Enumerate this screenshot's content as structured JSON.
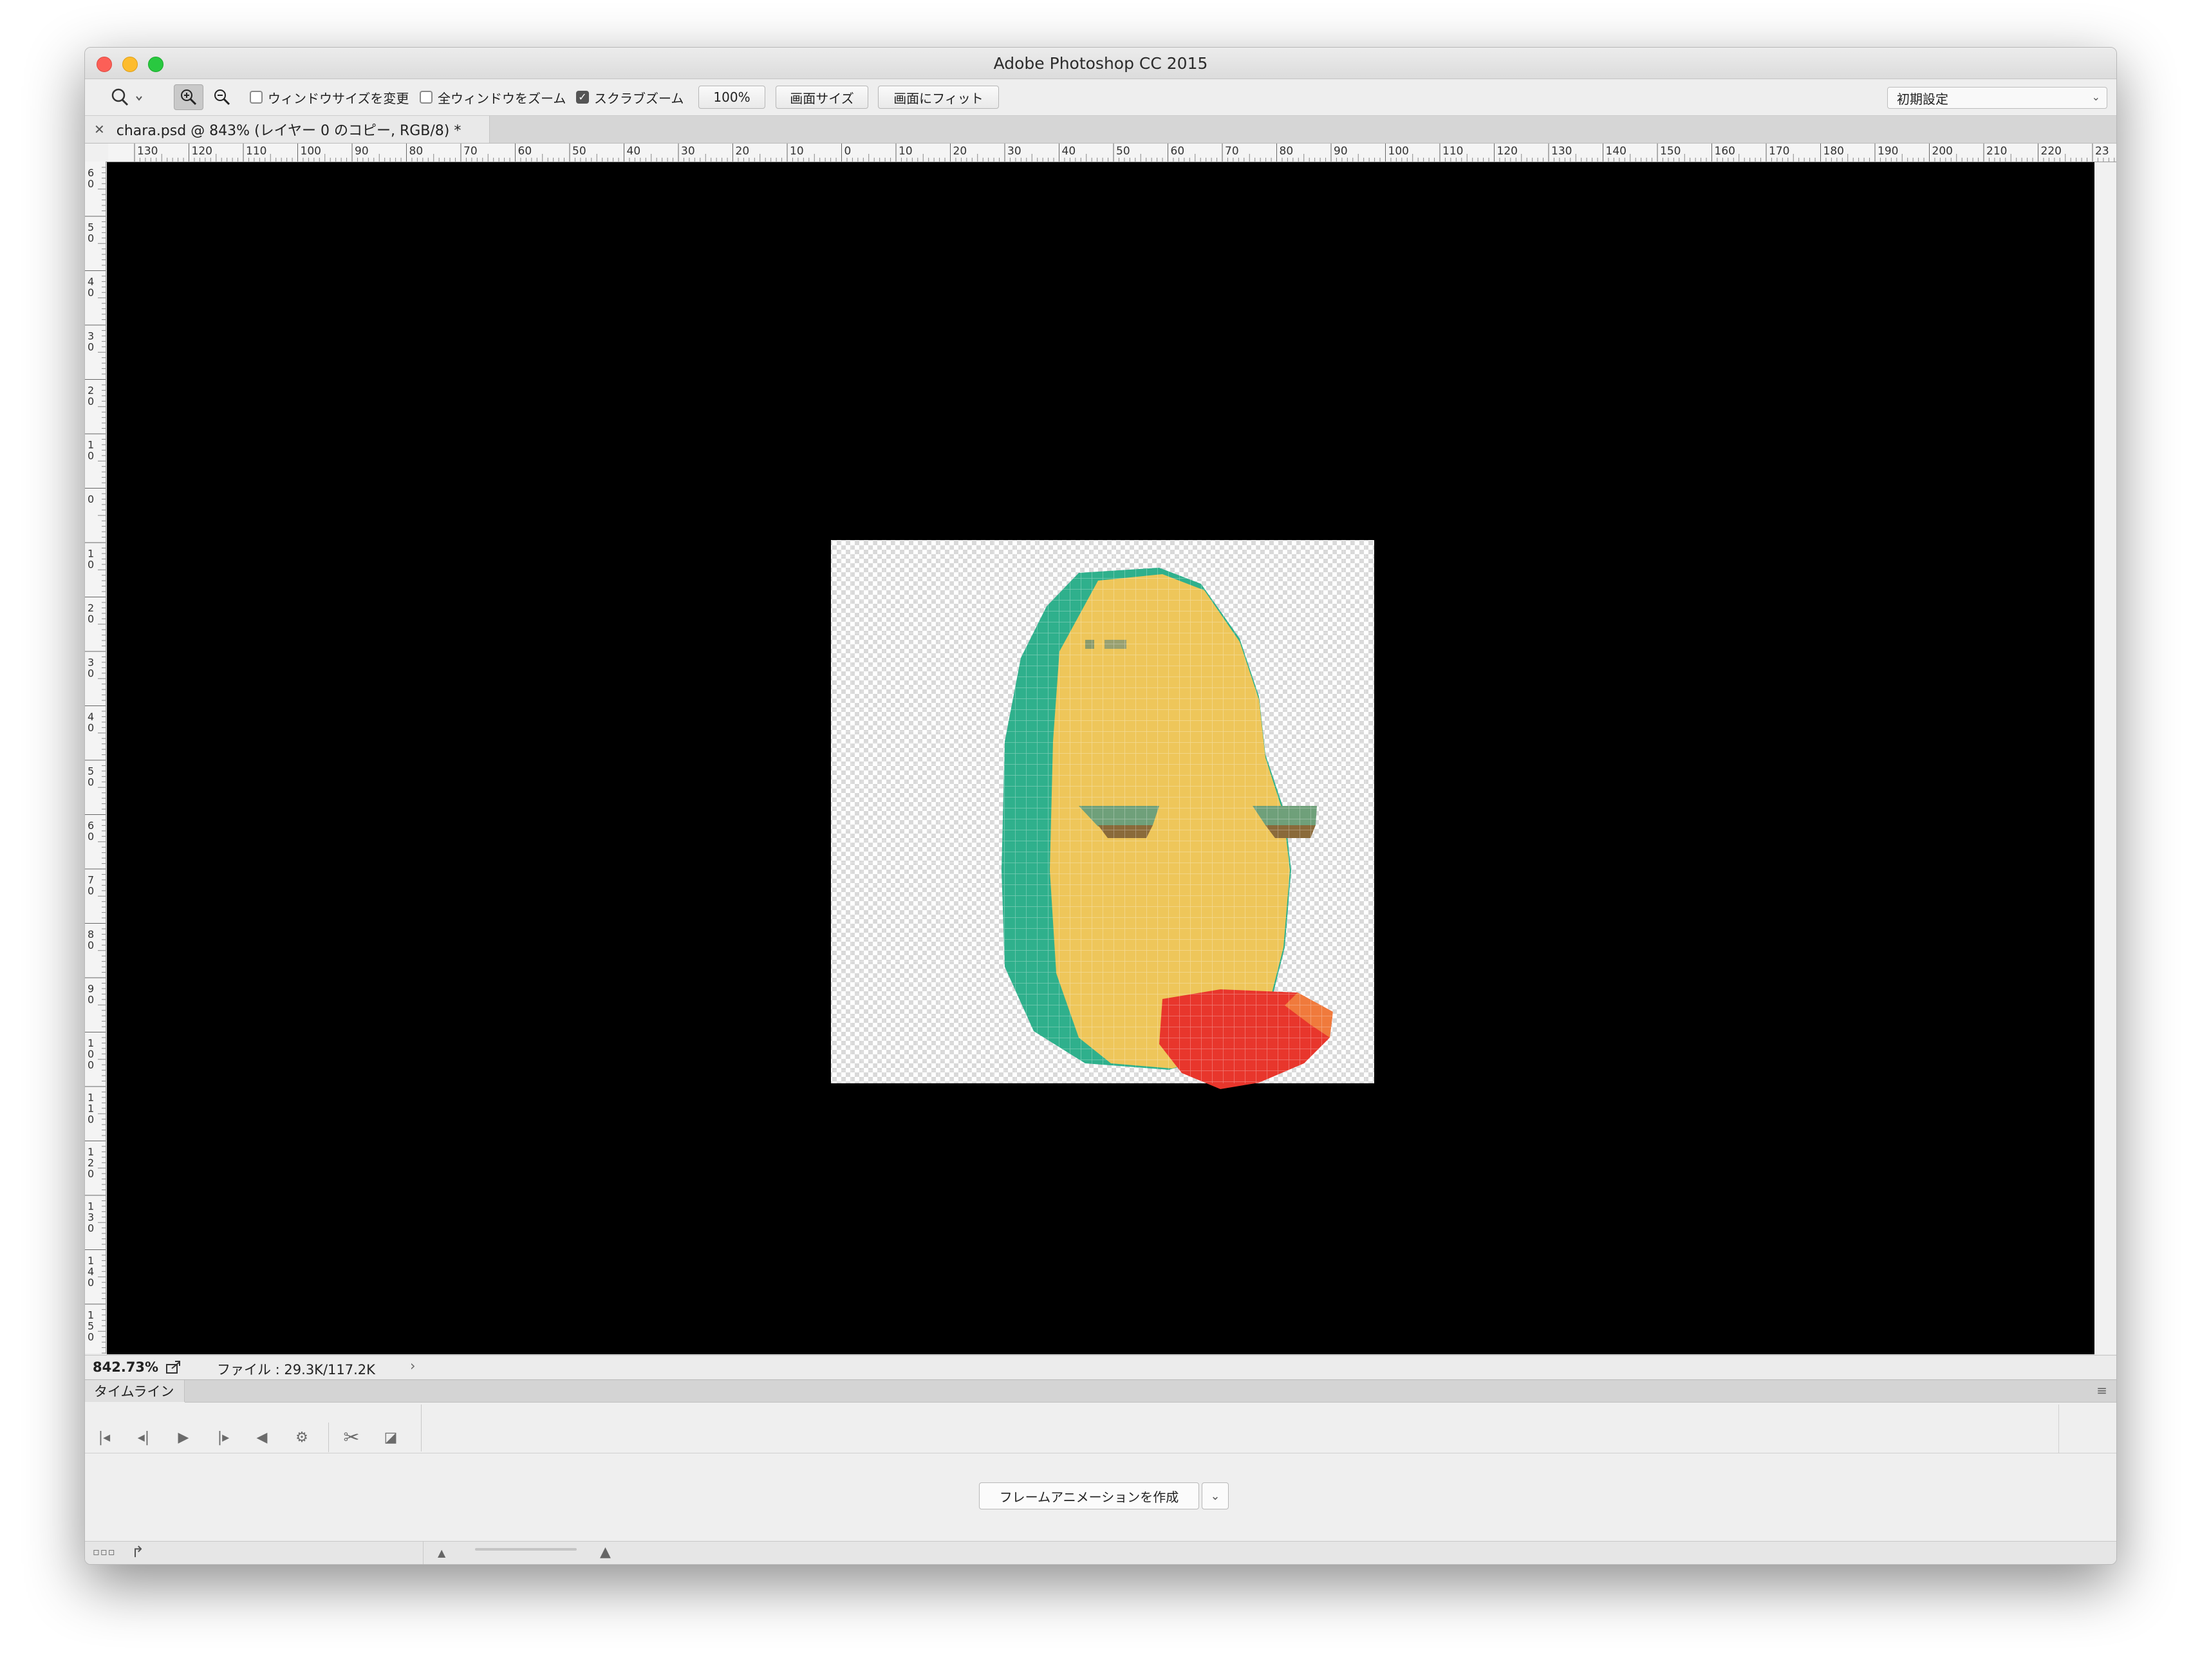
{
  "window": {
    "title": "Adobe Photoshop CC 2015"
  },
  "options": {
    "resize_windows_label": "ウィンドウサイズを変更",
    "resize_windows_checked": false,
    "zoom_all_label": "全ウィンドウをズーム",
    "zoom_all_checked": false,
    "scrubby_zoom_label": "スクラブズーム",
    "scrubby_zoom_checked": true,
    "zoom_100_label": "100%",
    "fit_screen_label": "画面サイズ",
    "fill_screen_label": "画面にフィット",
    "workspace_value": "初期設定"
  },
  "document": {
    "tab_label": "chara.psd @ 843% (レイヤー 0 のコピー, RGB/8) *"
  },
  "rulers": {
    "horizontal": [
      "130",
      "120",
      "110",
      "100",
      "90",
      "80",
      "70",
      "60",
      "50",
      "40",
      "30",
      "20",
      "10",
      "0",
      "10",
      "20",
      "30",
      "40",
      "50",
      "60",
      "70",
      "80",
      "90",
      "100",
      "110",
      "120",
      "130",
      "140",
      "150",
      "160",
      "170",
      "180",
      "190",
      "200",
      "210",
      "220",
      "23"
    ],
    "vertical": [
      "60",
      "50",
      "40",
      "30",
      "20",
      "10",
      "0",
      "10",
      "20",
      "30",
      "40",
      "50",
      "60",
      "70",
      "80",
      "90",
      "100",
      "110",
      "120",
      "130",
      "140",
      "150"
    ]
  },
  "status": {
    "zoom": "842.73%",
    "file_info": "ファイル : 29.3K/117.2K"
  },
  "timeline": {
    "tab_label": "タイムライン",
    "create_button_label": "フレームアニメーションを作成"
  },
  "icons": {
    "tool": "zoom-tool-icon",
    "zoom_in": "zoom-in-icon",
    "zoom_out": "zoom-out-icon",
    "share": "share-icon",
    "status_arrow": "chevron-right-icon",
    "panel_menu": "panel-menu-icon"
  },
  "colors": {
    "canvas_background": "#000000",
    "face_yellow": "#eec65a",
    "hair_green": "#2fb08c",
    "lips_red": "#e8362c",
    "close": "#fc5f57",
    "minimize": "#fdbc2e",
    "maximize": "#29c840"
  }
}
